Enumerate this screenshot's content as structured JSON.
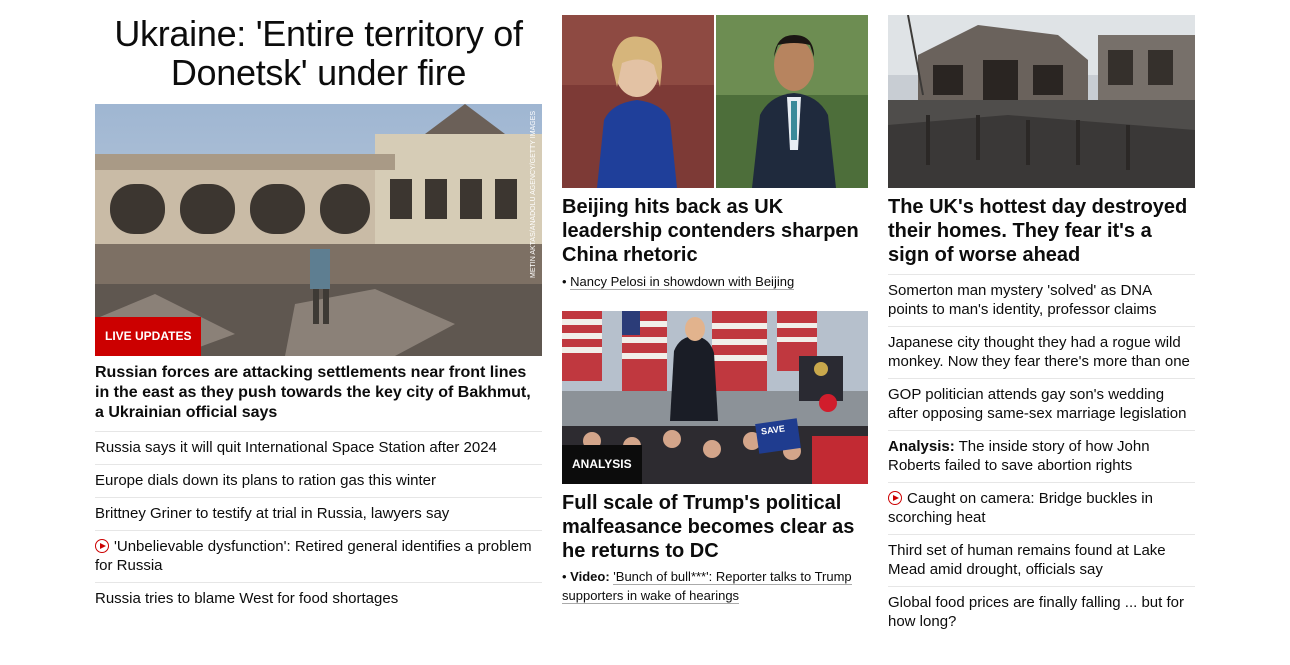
{
  "left": {
    "headline": "Ukraine: 'Entire territory of Donetsk' under fire",
    "badge": "LIVE UPDATES",
    "photo_credit": "METIN AKTAS/ANADOLU AGENCY/GETTY IMAGES",
    "lead": "Russian forces are attacking settlements near front lines in the east as they push towards the key city of Bakhmut, a Ukrainian official says",
    "items": [
      {
        "text": "Russia says it will quit International Space Station after 2024"
      },
      {
        "text": "Europe dials down its plans to ration gas this winter"
      },
      {
        "text": "Brittney Griner to testify at trial in Russia, lawyers say"
      },
      {
        "text": "'Unbelievable dysfunction': Retired general identifies a problem for Russia",
        "icon": "play-icon"
      },
      {
        "text": "Russia tries to blame West for food shortages"
      }
    ]
  },
  "mid": {
    "story1": {
      "title": "Beijing hits back as UK leadership contenders sharpen China rhetoric",
      "sub": "Nancy Pelosi in showdown with Beijing"
    },
    "story2": {
      "badge": "ANALYSIS",
      "title": "Full scale of Trump's political malfeasance becomes clear as he returns to DC",
      "sub_label": "Video:",
      "sub": "'Bunch of bull***': Reporter talks to Trump supporters in wake of hearings",
      "sign_text": "SAVE"
    }
  },
  "right": {
    "title": "The UK's hottest day destroyed their homes. They fear it's a sign of worse ahead",
    "items": [
      {
        "text": "Somerton man mystery 'solved' as DNA points to man's identity, professor claims"
      },
      {
        "text": "Japanese city thought they had a rogue wild monkey. Now they fear there's more than one"
      },
      {
        "text": "GOP politician attends gay son's wedding after opposing same-sex marriage legislation"
      },
      {
        "label": "Analysis:",
        "text": "The inside story of how John Roberts failed to save abortion rights"
      },
      {
        "text": "Caught on camera: Bridge buckles in scorching heat",
        "icon": "play-icon"
      },
      {
        "text": "Third set of human remains found at Lake Mead amid drought, officials say"
      },
      {
        "text": "Global food prices are finally falling ... but for how long?"
      }
    ]
  },
  "colors": {
    "accent": "#cc0000",
    "text": "#0c0c0c",
    "divider": "#e6e6e6"
  }
}
